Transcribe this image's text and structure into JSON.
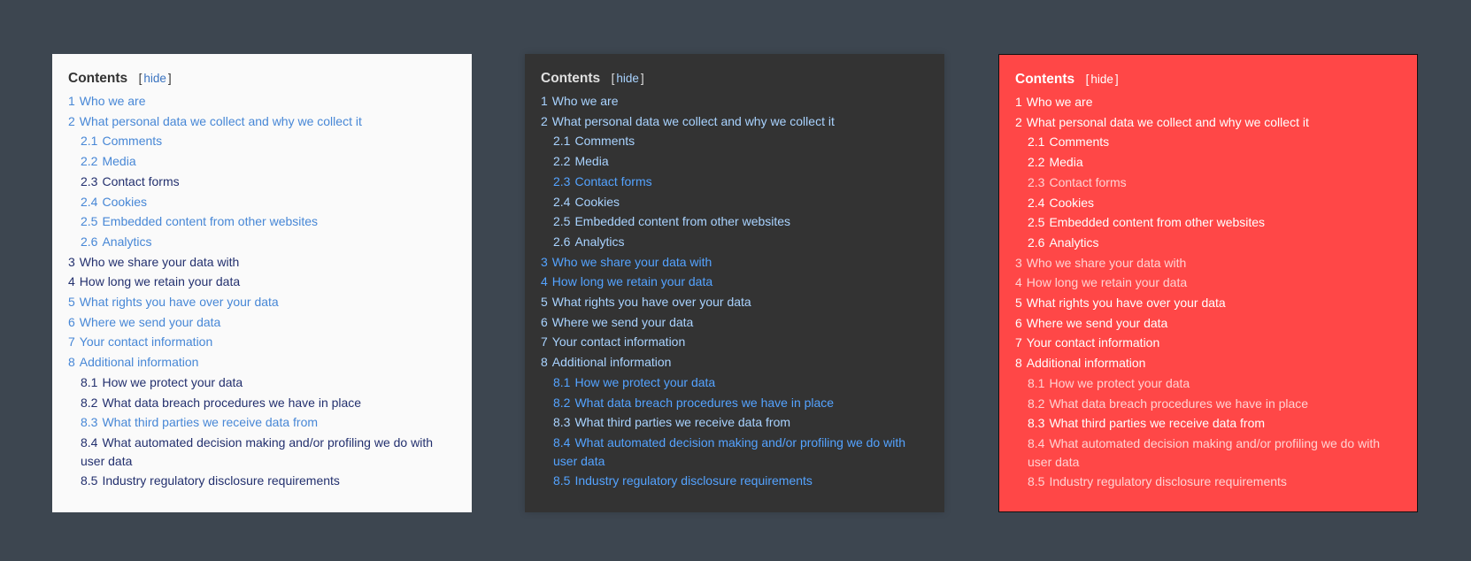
{
  "toc": {
    "title": "Contents",
    "toggle_open": "[",
    "toggle_label": "hide",
    "toggle_close": "]",
    "items": [
      {
        "num": "1",
        "label": "Who we are"
      },
      {
        "num": "2",
        "label": "What personal data we collect and why we collect it"
      },
      {
        "num": "2.1",
        "label": "Comments"
      },
      {
        "num": "2.2",
        "label": "Media"
      },
      {
        "num": "2.3",
        "label": "Contact forms"
      },
      {
        "num": "2.4",
        "label": "Cookies"
      },
      {
        "num": "2.5",
        "label": "Embedded content from other websites"
      },
      {
        "num": "2.6",
        "label": "Analytics"
      },
      {
        "num": "3",
        "label": "Who we share your data with"
      },
      {
        "num": "4",
        "label": "How long we retain your data"
      },
      {
        "num": "5",
        "label": "What rights you have over your data"
      },
      {
        "num": "6",
        "label": "Where we send your data"
      },
      {
        "num": "7",
        "label": "Your contact information"
      },
      {
        "num": "8",
        "label": "Additional information"
      },
      {
        "num": "8.1",
        "label": "How we protect your data"
      },
      {
        "num": "8.2",
        "label": "What data breach procedures we have in place"
      },
      {
        "num": "8.3",
        "label": "What third parties we receive data from"
      },
      {
        "num": "8.4",
        "label": "What automated decision making and/or profiling we do with user data"
      },
      {
        "num": "8.5",
        "label": "Industry regulatory disclosure requirements"
      }
    ]
  },
  "themes": {
    "light": {
      "background": "#fafafa",
      "link": "#4787d6",
      "visited": "#23306e"
    },
    "dark": {
      "background": "#333333",
      "link": "#a9d3ff",
      "visited": "#54a3ff"
    },
    "red": {
      "background": "#ff4747",
      "link": "#ffffff",
      "visited": "#ffd2d2"
    },
    "page_background": "#3d4650"
  }
}
